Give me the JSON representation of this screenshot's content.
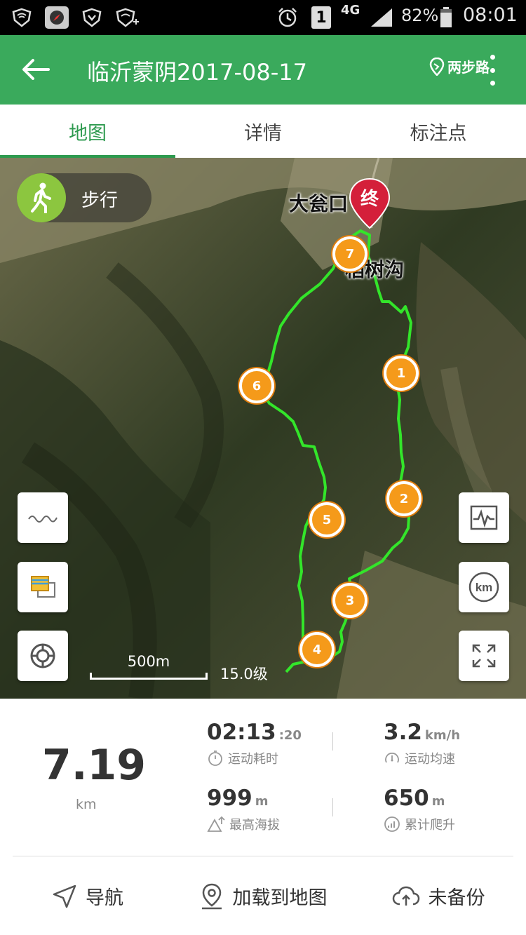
{
  "status_bar": {
    "icons": [
      "shield-wifi-icon",
      "compass-icon",
      "shield-icon",
      "wifi-icon",
      "alarm-icon",
      "sim-1-icon",
      "signal-icon",
      "battery-icon"
    ],
    "network": "4G",
    "battery": "82%",
    "time": "08:01"
  },
  "header": {
    "title": "临沂蒙阴2017-08-17",
    "watermark": "两步路"
  },
  "tabs": [
    {
      "label": "地图",
      "active": true
    },
    {
      "label": "详情",
      "active": false
    },
    {
      "label": "标注点",
      "active": false
    }
  ],
  "map": {
    "mode_label": "步行",
    "place_labels": [
      "大瓮口",
      "稻树沟"
    ],
    "end_marker_label": "终",
    "waypoints": [
      "1",
      "2",
      "3",
      "4",
      "5",
      "6",
      "7"
    ],
    "scale_label": "500m",
    "zoom_label": "15.0级",
    "track_color": "#33e52a",
    "waypoint_color": "#f59a1a"
  },
  "stats": {
    "distance_value": "7.19",
    "distance_unit": "km",
    "duration_main": "02:13",
    "duration_sec": ":20",
    "duration_label": "运动耗时",
    "speed_value": "3.2",
    "speed_unit": "km/h",
    "speed_label": "运动均速",
    "max_alt_value": "999",
    "max_alt_unit": "m",
    "max_alt_label": "最高海拔",
    "climb_value": "650",
    "climb_unit": "m",
    "climb_label": "累计爬升"
  },
  "actions": {
    "navigate": "导航",
    "load_to_map": "加载到地图",
    "backup": "未备份"
  },
  "colors": {
    "brand_green": "#3aaa5c",
    "tab_active": "#2e9a4f"
  }
}
